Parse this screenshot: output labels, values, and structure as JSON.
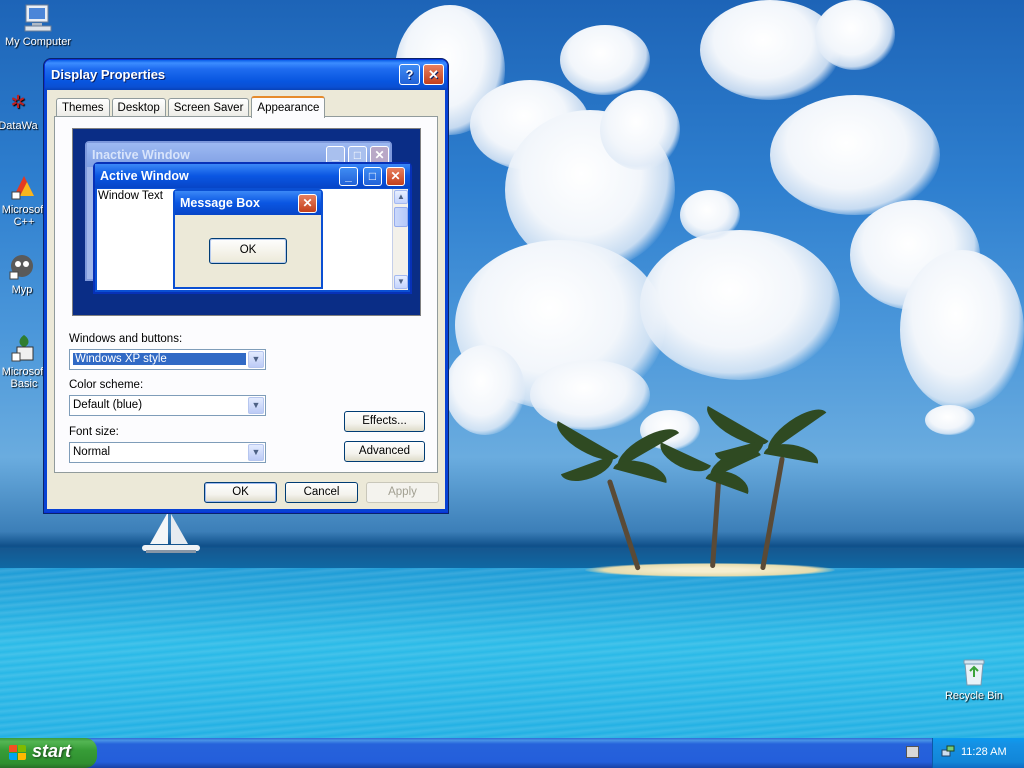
{
  "desktop_icons": [
    {
      "label": "My Computer",
      "icon": "my-computer-icon"
    },
    {
      "label": "DataWa",
      "icon": "datawa-icon"
    },
    {
      "label": "Microsoft C++",
      "icon": "msvc-icon"
    },
    {
      "label": "Myp",
      "icon": "myp-icon"
    },
    {
      "label": "Microsoft Basic",
      "icon": "msbasic-icon"
    },
    {
      "label": "Recycle Bin",
      "icon": "recycle-bin-icon"
    }
  ],
  "dialog": {
    "title": "Display Properties",
    "help_glyph": "?",
    "close_glyph": "✕",
    "tabs": [
      "Themes",
      "Desktop",
      "Screen Saver",
      "Appearance"
    ],
    "active_tab": "Appearance",
    "preview": {
      "inactive_title": "Inactive Window",
      "active_title": "Active Window",
      "window_text": "Window Text",
      "message_title": "Message Box",
      "message_ok": "OK"
    },
    "windows_buttons": {
      "label": "Windows and buttons:",
      "value": "Windows XP style"
    },
    "color_scheme": {
      "label": "Color scheme:",
      "value": "Default (blue)"
    },
    "font_size": {
      "label": "Font size:",
      "value": "Normal"
    },
    "effects_label": "Effects...",
    "advanced_label": "Advanced",
    "ok_label": "OK",
    "cancel_label": "Cancel",
    "apply_label": "Apply"
  },
  "taskbar": {
    "start_label": "start",
    "clock": "11:28 AM"
  },
  "colors": {
    "title_blue": "#0a56e2",
    "start_green": "#379d37",
    "tray_blue": "#1286d8"
  }
}
